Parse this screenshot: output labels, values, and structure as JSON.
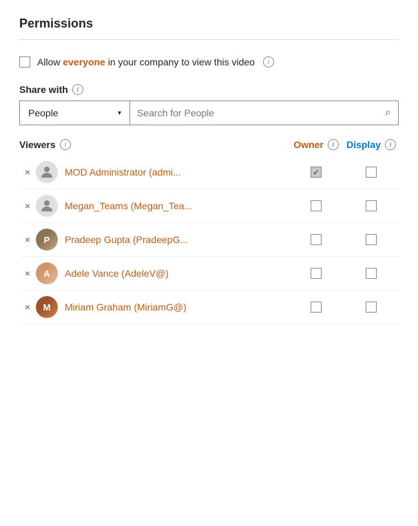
{
  "panel": {
    "title": "Permissions"
  },
  "allow_everyone": {
    "label_before": "Allow everyone in your company to view this video",
    "label_highlight": "everyone",
    "checked": false
  },
  "share_with": {
    "label": "Share with",
    "dropdown_value": "People",
    "search_placeholder": "Search for People"
  },
  "viewers_header": {
    "label": "Viewers",
    "owner_label": "Owner",
    "display_label": "Display"
  },
  "viewers": [
    {
      "id": 1,
      "name": "MOD Administrator (admi...",
      "avatar_type": "default",
      "owner_checked": true,
      "display_checked": false
    },
    {
      "id": 2,
      "name": "Megan_Teams (Megan_Tea...",
      "avatar_type": "default",
      "owner_checked": false,
      "display_checked": false
    },
    {
      "id": 3,
      "name": "Pradeep Gupta (PradeepG...",
      "avatar_type": "photo_pradeep",
      "owner_checked": false,
      "display_checked": false
    },
    {
      "id": 4,
      "name": "Adele Vance (AdeleV@)",
      "avatar_type": "photo_adele",
      "owner_checked": false,
      "display_checked": false
    },
    {
      "id": 5,
      "name": "Miriam Graham (MiriamG@)",
      "avatar_type": "photo_miriam",
      "owner_checked": false,
      "display_checked": false
    }
  ],
  "icons": {
    "info": "i",
    "chevron_down": "▾",
    "search": "🔍",
    "remove": "×",
    "checkmark": "✓"
  }
}
